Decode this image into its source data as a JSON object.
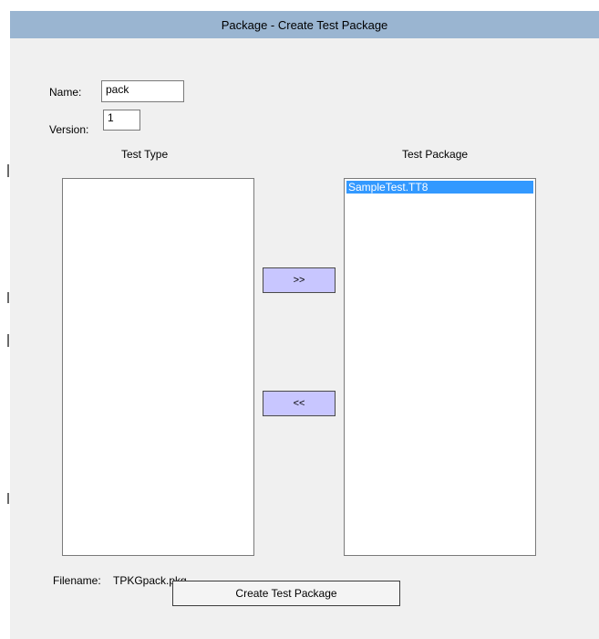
{
  "window": {
    "title": "Package - Create Test Package"
  },
  "form": {
    "name_label": "Name:",
    "name_value": "pack",
    "version_label": "Version:",
    "version_value": "1",
    "filename_label": "Filename:",
    "filename_value": "TPKGpack.pkg"
  },
  "test_type": {
    "header": "Test Type",
    "items": []
  },
  "test_package": {
    "header": "Test Package",
    "items": [
      {
        "label": "SampleTest.TT8",
        "selected": true
      }
    ]
  },
  "buttons": {
    "add_label": ">>",
    "remove_label": "<<",
    "create_label": "Create Test Package"
  },
  "colors": {
    "titlebar": "#9ab5d1",
    "window_bg": "#f0f0f0",
    "move_button_bg": "#c8c6ff",
    "selection": "#3399ff"
  }
}
